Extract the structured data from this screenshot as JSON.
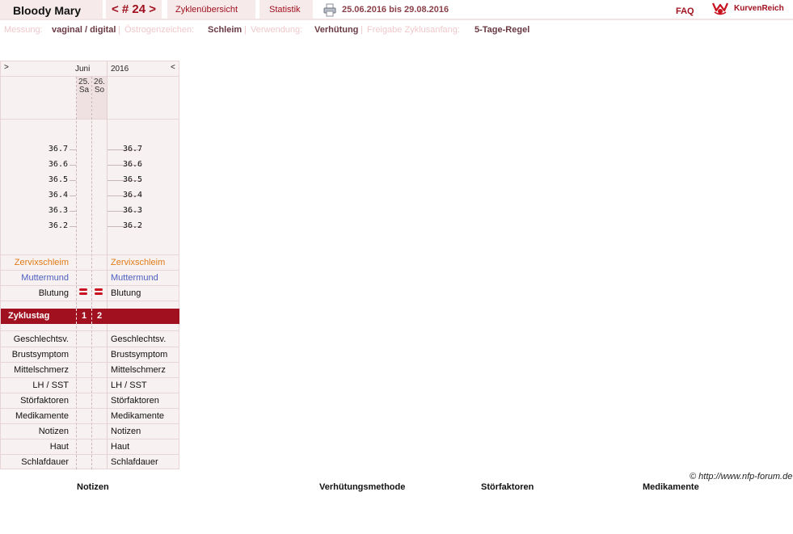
{
  "header": {
    "user_name": "Bloody Mary",
    "cycle_label": "< # 24 >",
    "overview_tab": "Zyklenübersicht",
    "stats_tab": "Statistik",
    "date_range": "25.06.2016 bis 29.08.2016",
    "faq": "FAQ",
    "brand": "KurvenReich"
  },
  "settings": {
    "measure_label": "Messung:",
    "measure_value": "vaginal / digital",
    "estrogen_label": "Östrogenzeichen:",
    "estrogen_value": "Schleim",
    "usage_label": "Verwendung:",
    "usage_value": "Verhütung",
    "release_label": "Freigabe Zyklusanfang:",
    "release_value": "5-Tage-Regel",
    "separator": "|"
  },
  "chart": {
    "nav_left": ">",
    "nav_right": "<",
    "month": "Juni",
    "year": "2016",
    "days": [
      {
        "date": "25.",
        "weekday": "Sa",
        "cycle_day": "1",
        "bleeding": true
      },
      {
        "date": "26.",
        "weekday": "So",
        "cycle_day": "2",
        "bleeding": true
      }
    ],
    "temperatures": [
      "36.7",
      "36.6",
      "36.5",
      "36.4",
      "36.3",
      "36.2"
    ],
    "rows": {
      "cervical_mucus": "Zervixschleim",
      "cervix": "Muttermund",
      "bleeding": "Blutung",
      "cycle_day": "Zyklustag",
      "intercourse": "Geschlechtsv.",
      "breast": "Brustsymptom",
      "mittelschmerz": "Mittelschmerz",
      "lh": "LH / SST",
      "disturbances": "Störfaktoren",
      "medication": "Medikamente",
      "notes": "Notizen",
      "skin": "Haut",
      "sleep": "Schlafdauer"
    }
  },
  "footer": {
    "copyright": "© http://www.nfp-forum.de",
    "notes_heading": "Notizen",
    "method_heading": "Verhütungsmethode",
    "disturb_heading": "Störfaktoren",
    "medication_heading": "Medikamente"
  },
  "colors": {
    "accent": "#a0101e",
    "mucus": "#e07b16",
    "cervix": "#4b5fbf"
  }
}
